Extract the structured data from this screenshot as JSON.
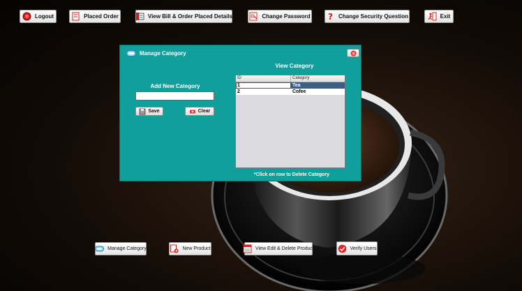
{
  "toolbar": {
    "logout": "Logout",
    "placed_order": "Placed Order",
    "view_bill": "View Bill & Order Placed Details",
    "change_password": "Change Password",
    "change_security_question": "Change Security Question",
    "exit": "Exit"
  },
  "dialog": {
    "title": "Manage Category",
    "add_label": "Add New Category",
    "input_value": "",
    "save_label": "Save",
    "clear_label": "Clear",
    "view_label": "View Category",
    "columns": [
      "ID",
      "Category"
    ],
    "rows": [
      {
        "id": "1",
        "category": "Tea"
      },
      {
        "id": "2",
        "category": "Cofee"
      }
    ],
    "footnote": "*Click on row to Delete Category"
  },
  "bottom_bar": {
    "manage_category": "Manage Category",
    "new_product": "New Product",
    "view_edit_delete_product": "View Edit & Delete Product",
    "verify_users": "Verify Users"
  },
  "colors": {
    "dialog_bg": "#109f9b",
    "selected_row": "#3d5f86"
  }
}
